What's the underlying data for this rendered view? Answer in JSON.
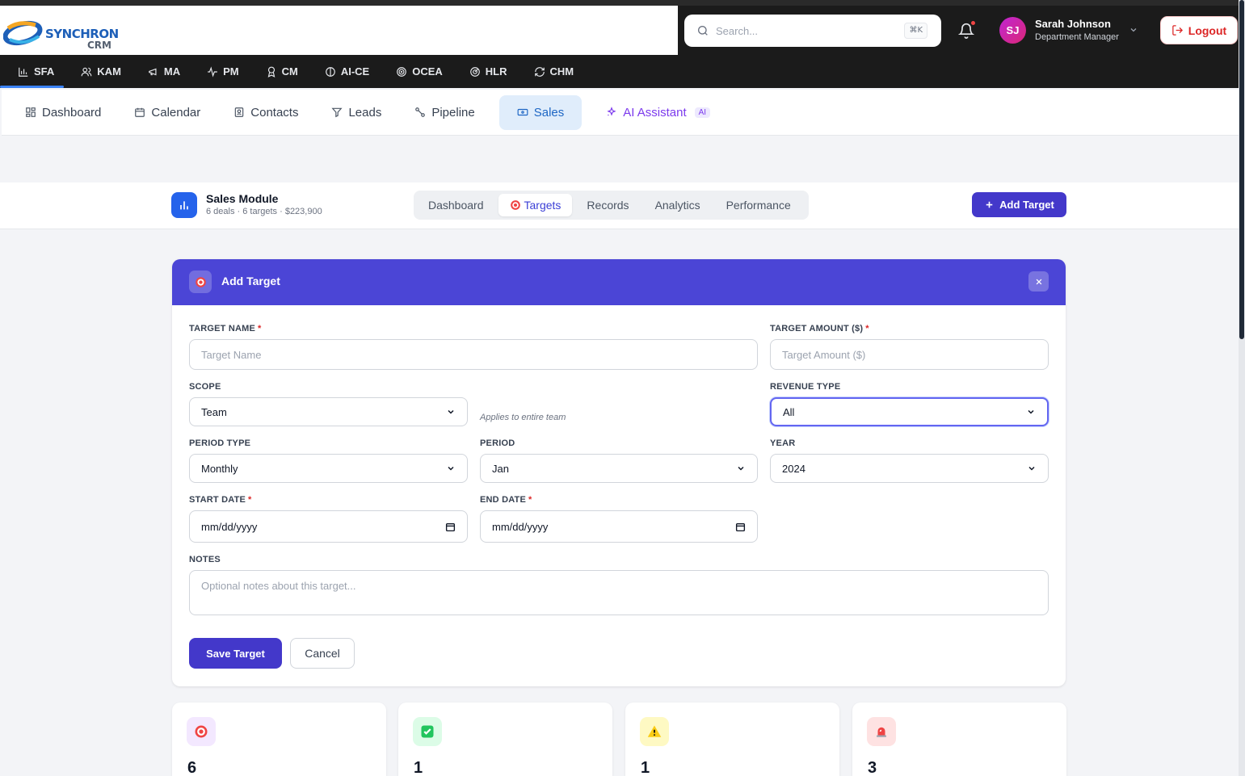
{
  "header": {
    "logo_text": "SYNCHRON",
    "logo_sub": "CRM",
    "search": {
      "placeholder": "Search...",
      "shortcut": "⌘K"
    },
    "user": {
      "initials": "SJ",
      "name": "Sarah Johnson",
      "role": "Department Manager"
    },
    "logout_label": "Logout"
  },
  "modules": [
    {
      "label": "SFA",
      "icon": "bar-chart-icon",
      "active": true
    },
    {
      "label": "KAM",
      "icon": "users-icon"
    },
    {
      "label": "MA",
      "icon": "megaphone-icon"
    },
    {
      "label": "PM",
      "icon": "activity-icon"
    },
    {
      "label": "CM",
      "icon": "award-icon"
    },
    {
      "label": "AI-CE",
      "icon": "brain-icon"
    },
    {
      "label": "OCEA",
      "icon": "target-icon"
    },
    {
      "label": "HLR",
      "icon": "radar-icon"
    },
    {
      "label": "CHM",
      "icon": "refresh-icon"
    }
  ],
  "subnav": [
    {
      "label": "Dashboard",
      "icon": "grid-icon"
    },
    {
      "label": "Calendar",
      "icon": "calendar-icon"
    },
    {
      "label": "Contacts",
      "icon": "contact-icon"
    },
    {
      "label": "Leads",
      "icon": "filter-icon"
    },
    {
      "label": "Pipeline",
      "icon": "pipeline-icon"
    },
    {
      "label": "Sales",
      "icon": "ticket-icon",
      "active": true
    },
    {
      "label": "AI Assistant",
      "icon": "sparkles-icon",
      "badge": "AI"
    }
  ],
  "module_header": {
    "title": "Sales Module",
    "subtitle": "6 deals · 6 targets · $223,900",
    "tabs": [
      "Dashboard",
      "Targets",
      "Records",
      "Analytics",
      "Performance"
    ],
    "active_tab": "Targets",
    "add_button": "Add Target"
  },
  "form": {
    "title": "Add Target",
    "target_name": {
      "label": "TARGET NAME",
      "placeholder": "Target Name"
    },
    "target_amount": {
      "label": "TARGET AMOUNT ($)",
      "placeholder": "Target Amount ($)"
    },
    "scope": {
      "label": "SCOPE",
      "value": "Team",
      "hint": "Applies to entire team"
    },
    "revenue_type": {
      "label": "REVENUE TYPE",
      "value": "All"
    },
    "period_type": {
      "label": "PERIOD TYPE",
      "value": "Monthly"
    },
    "period": {
      "label": "PERIOD",
      "value": "Jan"
    },
    "year": {
      "label": "YEAR",
      "value": "2024"
    },
    "start_date": {
      "label": "START DATE",
      "placeholder": "mm/dd/yyyy"
    },
    "end_date": {
      "label": "END DATE",
      "placeholder": "mm/dd/yyyy"
    },
    "notes": {
      "label": "NOTES",
      "placeholder": "Optional notes about this target..."
    },
    "required_marker": "*",
    "save_label": "Save Target",
    "cancel_label": "Cancel"
  },
  "stats": [
    {
      "icon": "target-icon",
      "value": "6",
      "color": "#f3e8ff"
    },
    {
      "icon": "check-icon",
      "value": "1",
      "color": "#dcfce7"
    },
    {
      "icon": "warning-icon",
      "value": "1",
      "color": "#fef9c3"
    },
    {
      "icon": "siren-icon",
      "value": "3",
      "color": "#fee2e2"
    }
  ],
  "colors": {
    "accent": "#4338ca",
    "form_header": "#4b45d6",
    "active_subnav": "#e0edfb"
  }
}
